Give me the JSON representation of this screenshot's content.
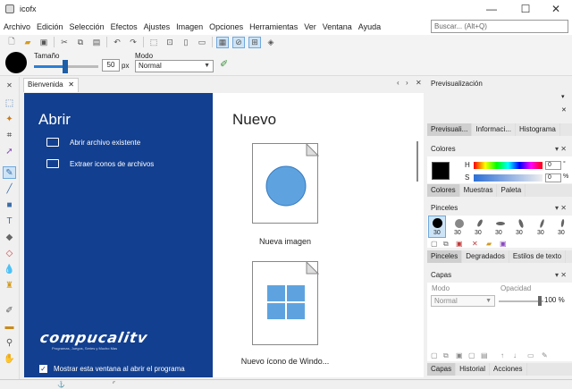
{
  "window": {
    "title": "icofx",
    "minimize": "—",
    "maximize": "☐",
    "close": "✕"
  },
  "menu": [
    "Archivo",
    "Edición",
    "Selección",
    "Efectos",
    "Ajustes",
    "Imagen",
    "Opciones",
    "Herramientas",
    "Ver",
    "Ventana",
    "Ayuda"
  ],
  "search": {
    "placeholder": "Buscar... (Alt+Q)"
  },
  "options": {
    "size_label": "Tamaño",
    "size_value": "50",
    "size_unit": "px",
    "mode_label": "Modo",
    "mode_value": "Normal",
    "size_fraction": 0.5
  },
  "doc_tab": {
    "label": "Bienvenida",
    "close": "✕"
  },
  "welcome": {
    "open_title": "Abrir",
    "open_items": [
      "Abrir archivo existente",
      "Extraer iconos de archivos"
    ],
    "new_title": "Nuevo",
    "new_items": [
      "Nueva imagen",
      "Nuevo ícono de Windo..."
    ],
    "show_checkbox": "Mostrar esta ventana al abrir el programa",
    "brand": "compucalitv",
    "brand_sub": "Programas, Juegos, Series y Mucho Mas"
  },
  "panels": {
    "preview": {
      "title": "Previsualización",
      "tabs": [
        "Previsuali...",
        "Informaci...",
        "Histograma"
      ]
    },
    "colors": {
      "title": "Colores",
      "h_label": "H",
      "s_label": "S",
      "h_value": "0",
      "s_value": "0",
      "h_unit": "°",
      "s_unit": "%",
      "tabs": [
        "Colores",
        "Muestras",
        "Paleta"
      ]
    },
    "brushes": {
      "title": "Pinceles",
      "sizes": [
        "30",
        "30",
        "30",
        "30",
        "30",
        "30",
        "30"
      ],
      "tabs": [
        "Pinceles",
        "Degradados",
        "Estilos de texto"
      ]
    },
    "layers": {
      "title": "Capas",
      "mode_label": "Modo",
      "opacity_label": "Opacidad",
      "mode_value": "Normal",
      "opacity_value": "100 %",
      "tabs": [
        "Capas",
        "Historial",
        "Acciones"
      ]
    }
  },
  "colors": {
    "accent": "#123f8f",
    "selection": "#cde4f7",
    "win_tile": "#5ea3e0"
  }
}
